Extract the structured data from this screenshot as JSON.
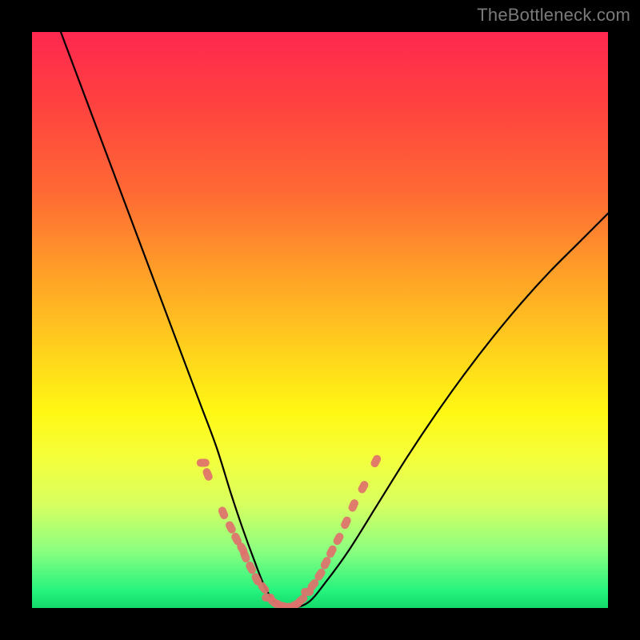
{
  "watermark": "TheBottleneck.com",
  "colors": {
    "curve": "#000000",
    "markers": "#e0716c",
    "frame_bg": "#000000"
  },
  "chart_data": {
    "type": "line",
    "title": "",
    "xlabel": "",
    "ylabel": "",
    "xlim": [
      0,
      1
    ],
    "ylim": [
      0,
      1
    ],
    "curve": {
      "x": [
        0.05,
        0.08,
        0.11,
        0.14,
        0.17,
        0.2,
        0.23,
        0.26,
        0.29,
        0.32,
        0.345,
        0.365,
        0.385,
        0.405,
        0.425,
        0.45,
        0.48,
        0.51,
        0.55,
        0.6,
        0.65,
        0.7,
        0.75,
        0.8,
        0.85,
        0.9,
        0.95,
        1.0
      ],
      "y": [
        1.0,
        0.92,
        0.84,
        0.76,
        0.68,
        0.6,
        0.52,
        0.44,
        0.36,
        0.28,
        0.2,
        0.14,
        0.085,
        0.035,
        0.007,
        0.0,
        0.01,
        0.045,
        0.1,
        0.18,
        0.26,
        0.335,
        0.405,
        0.47,
        0.53,
        0.585,
        0.635,
        0.685
      ]
    },
    "markers_left": {
      "x": [
        0.297,
        0.305,
        0.332,
        0.345,
        0.355,
        0.365,
        0.37,
        0.38,
        0.39,
        0.402
      ],
      "y": [
        0.252,
        0.232,
        0.165,
        0.14,
        0.12,
        0.103,
        0.09,
        0.07,
        0.05,
        0.035
      ]
    },
    "markers_right": {
      "x": [
        0.478,
        0.488,
        0.5,
        0.51,
        0.52,
        0.532,
        0.545,
        0.558,
        0.575,
        0.597
      ],
      "y": [
        0.028,
        0.04,
        0.058,
        0.078,
        0.098,
        0.12,
        0.148,
        0.178,
        0.21,
        0.255
      ]
    },
    "markers_bottom": {
      "x": [
        0.41,
        0.42,
        0.43,
        0.44,
        0.45,
        0.458,
        0.468
      ],
      "y": [
        0.018,
        0.01,
        0.005,
        0.002,
        0.002,
        0.006,
        0.014
      ]
    }
  }
}
